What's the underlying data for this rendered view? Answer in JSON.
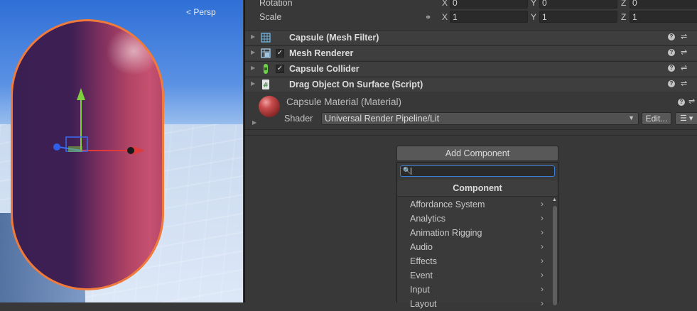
{
  "scene": {
    "view_mode_label": "Persp",
    "colors": {
      "capsule_outline": "#f07a3c",
      "sky": "#2f6fd6"
    }
  },
  "transform": {
    "rotation": {
      "label": "Rotation",
      "x_axis": "X",
      "x": "0",
      "y_axis": "Y",
      "y": "0",
      "z_axis": "Z",
      "z": "0"
    },
    "scale": {
      "label": "Scale",
      "x_axis": "X",
      "x": "1",
      "y_axis": "Y",
      "y": "1",
      "z_axis": "Z",
      "z": "1",
      "link_icon": "link-icon"
    }
  },
  "components": [
    {
      "name": "Capsule (Mesh Filter)",
      "icon": "mesh-filter-icon",
      "has_checkbox": false
    },
    {
      "name": "Mesh Renderer",
      "icon": "mesh-renderer-icon",
      "has_checkbox": true,
      "enabled": true
    },
    {
      "name": "Capsule Collider",
      "icon": "capsule-collider-icon",
      "has_checkbox": true,
      "enabled": true
    },
    {
      "name": "Drag Object On Surface (Script)",
      "icon": "script-icon",
      "has_checkbox": false
    }
  ],
  "material": {
    "name": "Capsule Material (Material)",
    "shader_label": "Shader",
    "shader_value": "Universal Render Pipeline/Lit",
    "edit_label": "Edit...",
    "list_icon": "list-icon"
  },
  "add_component": {
    "button_label": "Add Component",
    "search_placeholder": "",
    "header": "Component",
    "items": [
      "Affordance System",
      "Analytics",
      "Animation Rigging",
      "Audio",
      "Effects",
      "Event",
      "Input",
      "Layout"
    ]
  }
}
